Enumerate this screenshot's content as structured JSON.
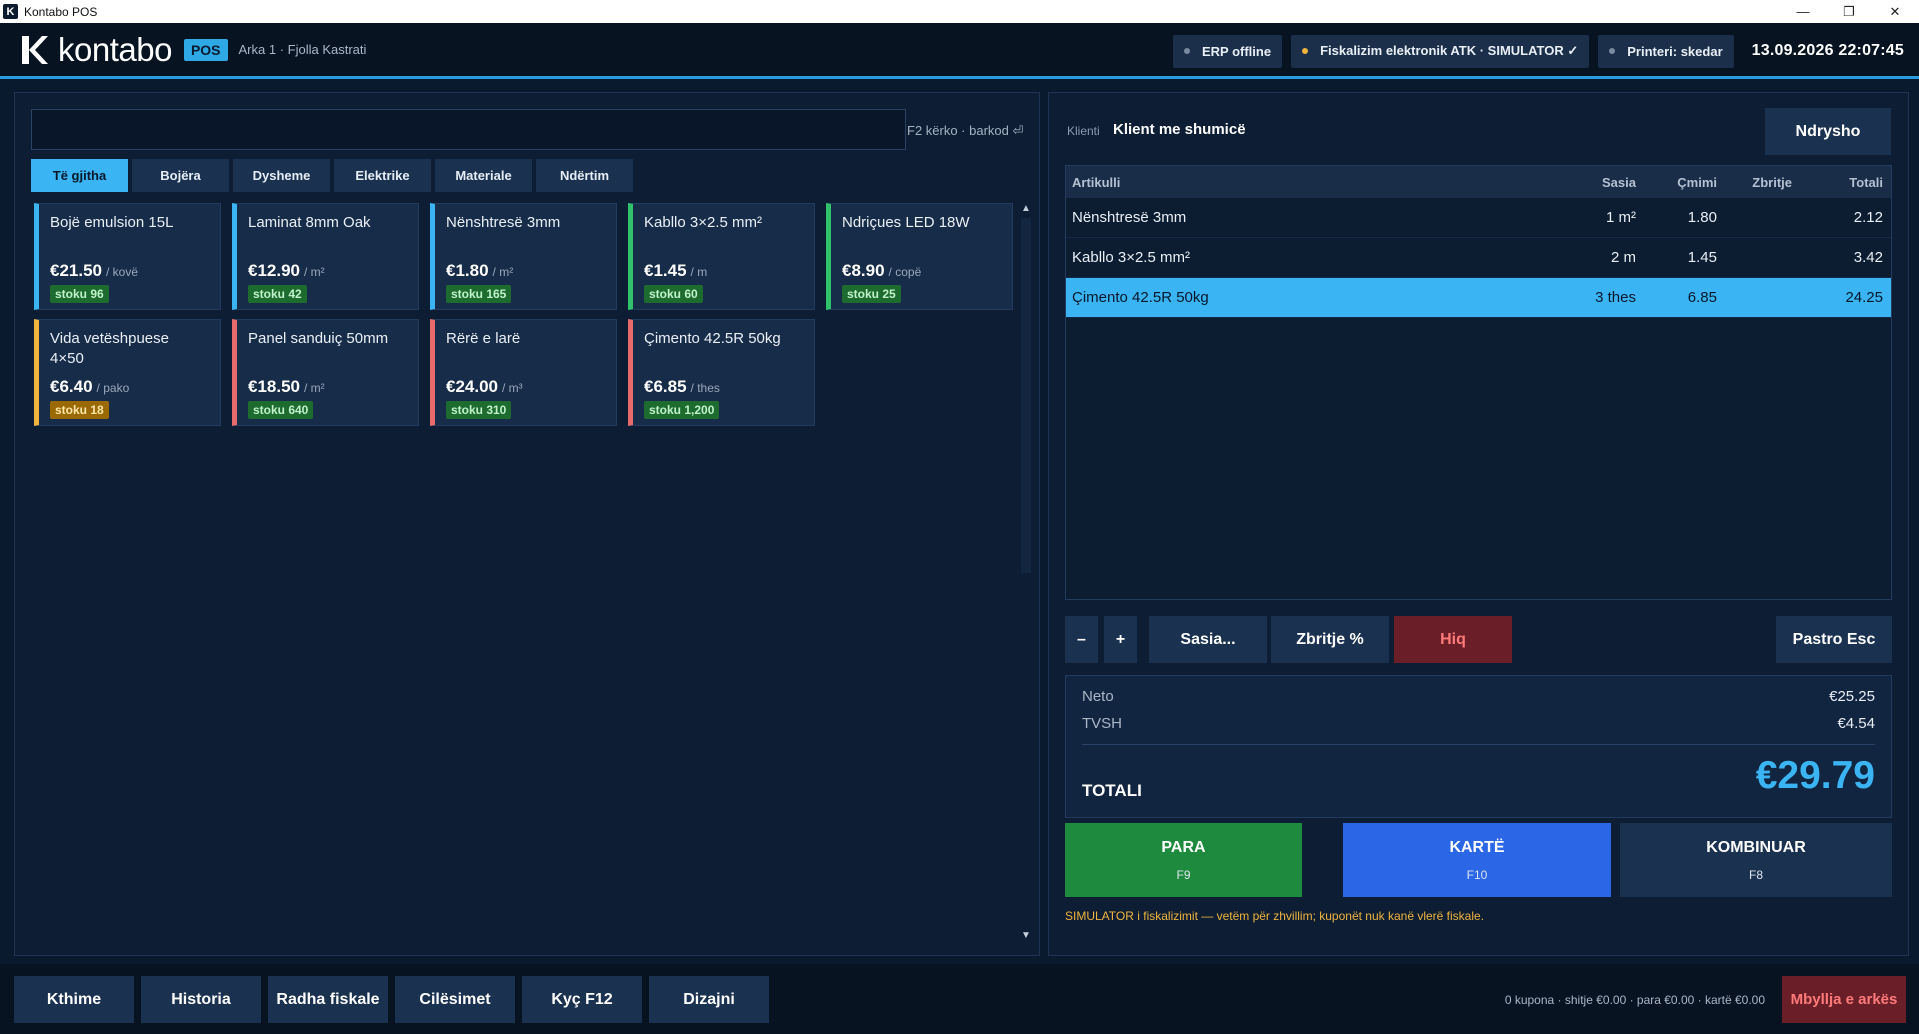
{
  "window": {
    "title": "Kontabo POS",
    "icon_letter": "K"
  },
  "header": {
    "logo_text": "kontabo",
    "badge": "POS",
    "session": "Arka 1 · Fjolla Kastrati",
    "statuses": [
      {
        "label": "ERP offline",
        "dot_color": "#7a8aa0"
      },
      {
        "label": "Fiskalizim elektronik ATK · SIMULATOR ✓",
        "dot_color": "#f0b43c"
      },
      {
        "label": "Printeri: skedar",
        "dot_color": "#7a8aa0"
      }
    ],
    "datetime": "13.09.2026  22:07:45"
  },
  "search": {
    "value": "",
    "hint": "F2 kërko · barkod ⏎"
  },
  "categories": [
    "Të gjitha",
    "Bojëra",
    "Dysheme",
    "Elektrike",
    "Materiale",
    "Ndërtim"
  ],
  "active_category": "Të gjitha",
  "products": [
    {
      "name": "Bojë emulsion 15L",
      "price": "€21.50",
      "unit": "/ kovë",
      "stock": "stoku 96",
      "stock_level": "ok",
      "accent": "#3ab4f2"
    },
    {
      "name": "Laminat 8mm Oak",
      "price": "€12.90",
      "unit": "/ m²",
      "stock": "stoku 42",
      "stock_level": "ok",
      "accent": "#3ab4f2"
    },
    {
      "name": "Nënshtresë 3mm",
      "price": "€1.80",
      "unit": "/ m²",
      "stock": "stoku 165",
      "stock_level": "ok",
      "accent": "#3ab4f2"
    },
    {
      "name": "Kabllo 3×2.5 mm²",
      "price": "€1.45",
      "unit": "/ m",
      "stock": "stoku 60",
      "stock_level": "ok",
      "accent": "#2fc26a"
    },
    {
      "name": "Ndriçues LED 18W",
      "price": "€8.90",
      "unit": "/ copë",
      "stock": "stoku 25",
      "stock_level": "ok",
      "accent": "#2fc26a"
    },
    {
      "name": "Vida vetëshpuese\n4×50",
      "price": "€6.40",
      "unit": "/ pako",
      "stock": "stoku 18",
      "stock_level": "low",
      "accent": "#f0b43c"
    },
    {
      "name": "Panel sanduiç 50mm",
      "price": "€18.50",
      "unit": "/ m²",
      "stock": "stoku 640",
      "stock_level": "ok",
      "accent": "#e86a6a"
    },
    {
      "name": "Rërë e larë",
      "price": "€24.00",
      "unit": "/ m³",
      "stock": "stoku 310",
      "stock_level": "ok",
      "accent": "#e86a6a"
    },
    {
      "name": "Çimento 42.5R 50kg",
      "price": "€6.85",
      "unit": "/ thes",
      "stock": "stoku 1,200",
      "stock_level": "ok",
      "accent": "#e86a6a"
    }
  ],
  "customer": {
    "label": "Klienti",
    "name": "Klient me shumicë",
    "change_button": "Ndrysho"
  },
  "cart": {
    "columns": [
      "Artikulli",
      "Sasia",
      "Çmimi",
      "Zbritje",
      "Totali"
    ],
    "rows": [
      {
        "item": "Nënshtresë 3mm",
        "qty": "1 m²",
        "price": "1.80",
        "discount": "",
        "total": "2.12",
        "selected": false
      },
      {
        "item": "Kabllo 3×2.5 mm²",
        "qty": "2 m",
        "price": "1.45",
        "discount": "",
        "total": "3.42",
        "selected": false
      },
      {
        "item": "Çimento 42.5R 50kg",
        "qty": "3 thes",
        "price": "6.85",
        "discount": "",
        "total": "24.25",
        "selected": true
      }
    ]
  },
  "cart_actions": {
    "minus": "–",
    "plus": "+",
    "qty": "Sasia...",
    "discount": "Zbritje %",
    "remove": "Hiq",
    "clear": "Pastro  Esc"
  },
  "totals": {
    "net_label": "Neto",
    "net": "€25.25",
    "vat_label": "TVSH",
    "vat": "€4.54",
    "total_label": "TOTALI",
    "total": "€29.79"
  },
  "payments": [
    {
      "label": "PARA",
      "key": "F9",
      "color": "#1e8a3e"
    },
    {
      "label": "KARTË",
      "key": "F10",
      "color": "#2a66e6"
    },
    {
      "label": "KOMBINUAR",
      "key": "F8",
      "color": "#1b3150"
    }
  ],
  "simulator_note": "SIMULATOR i fiskalizimit — vetëm për zhvillim; kuponët nuk kanë vlerë fiskale.",
  "footer": {
    "buttons": [
      "Kthime",
      "Historia",
      "Radha fiskale",
      "Cilësimet",
      "Kyç  F12",
      "Dizajni"
    ],
    "summary": "0 kupona · shitje €0.00 · para €0.00 · kartë €0.00",
    "close_register": "Mbyllja e arkës"
  }
}
